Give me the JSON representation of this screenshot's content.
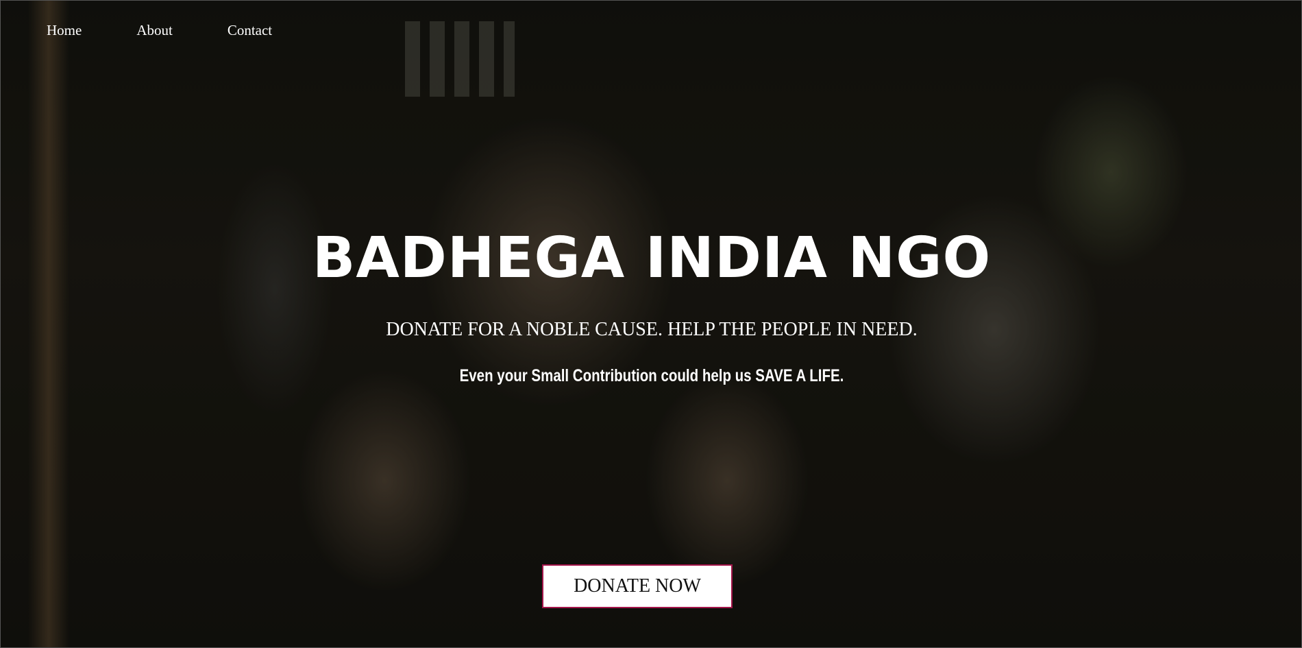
{
  "nav": {
    "items": [
      {
        "label": "Home"
      },
      {
        "label": "About"
      },
      {
        "label": "Contact"
      }
    ]
  },
  "hero": {
    "title": "BADHEGA INDIA NGO",
    "tagline": "DONATE FOR A NOBLE CAUSE. HELP THE PEOPLE IN NEED.",
    "subtitle": "Even your Small Contribution could help us SAVE A LIFE.",
    "donate_label": "DONATE NOW",
    "image": "children-carrying-bananas-photo"
  },
  "colors": {
    "text": "#ffffff",
    "button_bg": "#ffffff",
    "button_border": "#a3154a",
    "button_text": "#111111"
  }
}
